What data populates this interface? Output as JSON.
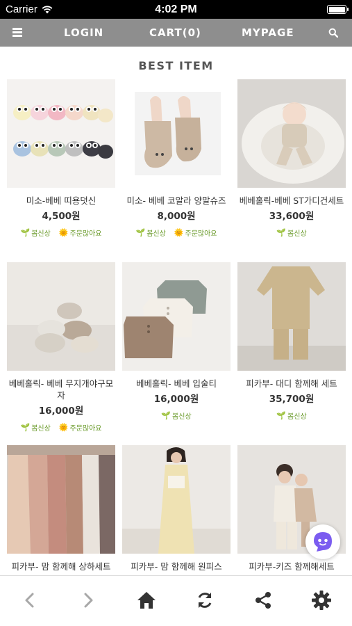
{
  "status": {
    "carrier": "Carrier",
    "time": "4:02 PM"
  },
  "nav": {
    "login": "LOGIN",
    "cart": "CART(0)",
    "mypage": "MYPAGE"
  },
  "section_title": "BEST ITEM",
  "products": [
    {
      "name": "미소-베베 띠용덧신",
      "price": "4,500원",
      "badges": [
        "봄신상",
        "주문많아요"
      ]
    },
    {
      "name": "미소- 베베 코알라 양말슈즈",
      "price": "8,000원",
      "badges": [
        "봄신상",
        "주문많아요"
      ]
    },
    {
      "name": "베베홀릭-베베 ST가디건세트",
      "price": "33,600원",
      "badges": [
        "봄신상"
      ]
    },
    {
      "name": "베베홀릭- 베베 무지개야구모자",
      "price": "16,000원",
      "badges": [
        "봄신상",
        "주문많아요"
      ]
    },
    {
      "name": "베베홀릭- 베베 입술티",
      "price": "16,000원",
      "badges": [
        "봄신상"
      ]
    },
    {
      "name": "피카부- 대디 함께해 세트",
      "price": "35,700원",
      "badges": [
        "봄신상"
      ]
    },
    {
      "name": "피카부- 맘 함께해 상하세트",
      "price": "",
      "badges": []
    },
    {
      "name": "피카부- 맘 함께해 원피스",
      "price": "",
      "badges": []
    },
    {
      "name": "피카부-키즈 함께해세트",
      "price": "",
      "badges": []
    }
  ],
  "icons": {
    "menu": "menu-icon",
    "search": "search-icon",
    "back": "chevron-left-icon",
    "forward": "chevron-right-icon",
    "home": "home-icon",
    "refresh": "refresh-icon",
    "share": "share-icon",
    "settings": "gear-icon",
    "chat": "chat-bot-icon"
  },
  "colors": {
    "nav_bg": "#8e8e8e",
    "badge_green": "#6a9a2a",
    "chat_purple": "#7b5cf0"
  }
}
